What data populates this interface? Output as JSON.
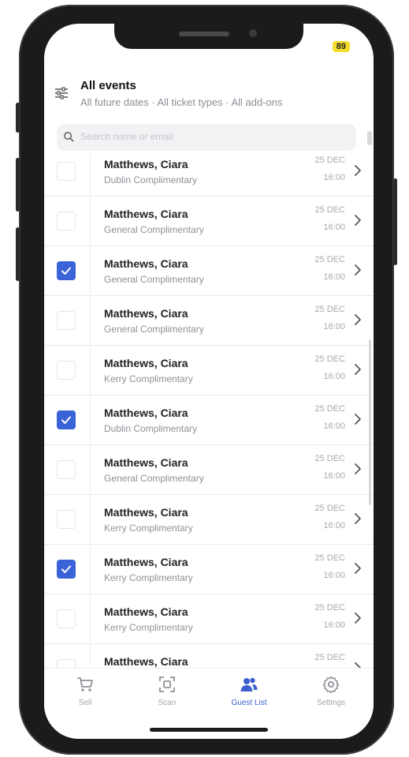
{
  "status": {
    "battery": "89"
  },
  "header": {
    "title": "All events",
    "subtitle": "All future dates · All ticket types · All add-ons"
  },
  "search": {
    "placeholder": "Search name or email"
  },
  "guests": [
    {
      "name": "Matthews, Ciara",
      "ticket": "Dublin Complimentary",
      "date": "25 DEC",
      "time": "16:00",
      "checked": false
    },
    {
      "name": "Matthews, Ciara",
      "ticket": "General Complimentary",
      "date": "25 DEC",
      "time": "16:00",
      "checked": false
    },
    {
      "name": "Matthews, Ciara",
      "ticket": "General Complimentary",
      "date": "25 DEC",
      "time": "16:00",
      "checked": true
    },
    {
      "name": "Matthews, Ciara",
      "ticket": "General Complimentary",
      "date": "25 DEC",
      "time": "16:00",
      "checked": false
    },
    {
      "name": "Matthews, Ciara",
      "ticket": "Kerry Complimentary",
      "date": "25 DEC",
      "time": "16:00",
      "checked": false
    },
    {
      "name": "Matthews, Ciara",
      "ticket": "Dublin Complimentary",
      "date": "25 DEC",
      "time": "16:00",
      "checked": true
    },
    {
      "name": "Matthews, Ciara",
      "ticket": "General Complimentary",
      "date": "25 DEC",
      "time": "16:00",
      "checked": false
    },
    {
      "name": "Matthews, Ciara",
      "ticket": "Kerry Complimentary",
      "date": "25 DEC",
      "time": "16:00",
      "checked": false
    },
    {
      "name": "Matthews, Ciara",
      "ticket": "Kerry Complimentary",
      "date": "25 DEC",
      "time": "16:00",
      "checked": true
    },
    {
      "name": "Matthews, Ciara",
      "ticket": "Kerry Complimentary",
      "date": "25 DEC",
      "time": "16:00",
      "checked": false
    },
    {
      "name": "Matthews, Ciara",
      "ticket": "",
      "date": "25 DEC",
      "time": "",
      "checked": false
    }
  ],
  "tabs": [
    {
      "label": "Sell",
      "icon": "cart-icon",
      "active": false
    },
    {
      "label": "Scan",
      "icon": "scan-icon",
      "active": false
    },
    {
      "label": "Guest List",
      "icon": "guest-list-icon",
      "active": true
    },
    {
      "label": "Settings",
      "icon": "gear-icon",
      "active": false
    }
  ],
  "colors": {
    "accent": "#3b63d8",
    "battery": "#f2de2c"
  }
}
